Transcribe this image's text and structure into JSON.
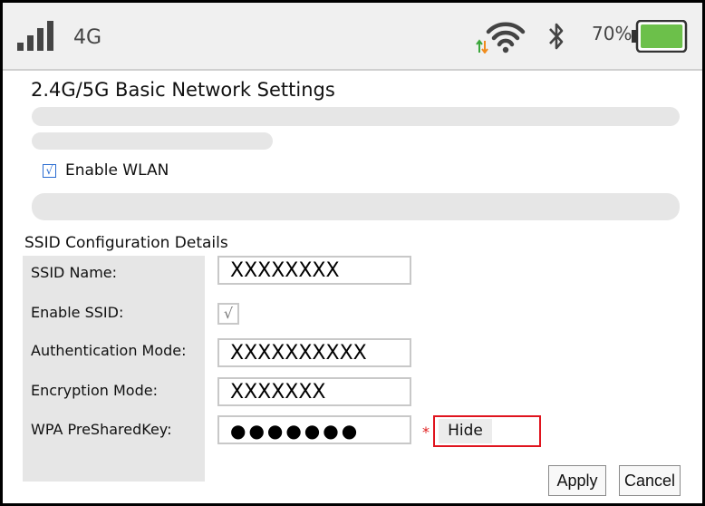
{
  "status_bar": {
    "network_type": "4G",
    "battery_percent": "70%",
    "battery_level": 0.7,
    "icons": [
      "signal-icon",
      "wifi-icon",
      "bluetooth-icon",
      "battery-icon"
    ]
  },
  "page": {
    "title": "2.4G/5G Basic Network Settings"
  },
  "wlan": {
    "checkbox_mark": "√",
    "label": "Enable WLAN",
    "checked": true
  },
  "ssid_config": {
    "heading": "SSID Configuration Details",
    "ssid_name_label": "SSID Name:",
    "ssid_name_value": "XXXXXXXX",
    "enable_ssid_label": "Enable SSID:",
    "enable_ssid_mark": "√",
    "auth_mode_label": "Authentication Mode:",
    "auth_mode_value": "XXXXXXXXXX",
    "encryption_mode_label": "Encryption Mode:",
    "encryption_mode_value": "XXXXXXX",
    "wpa_key_label": "WPA PreSharedKey:",
    "wpa_key_value": "●●●●●●●",
    "required_marker": "*",
    "hide_label": "Hide"
  },
  "actions": {
    "apply_label": "Apply",
    "cancel_label": "Cancel"
  },
  "colors": {
    "accent_blue": "#2a6cd1",
    "highlight_red": "#e0141e",
    "battery_green": "#6cc04a",
    "arrow_green": "#3aa63a",
    "arrow_orange": "#f08c1e"
  }
}
